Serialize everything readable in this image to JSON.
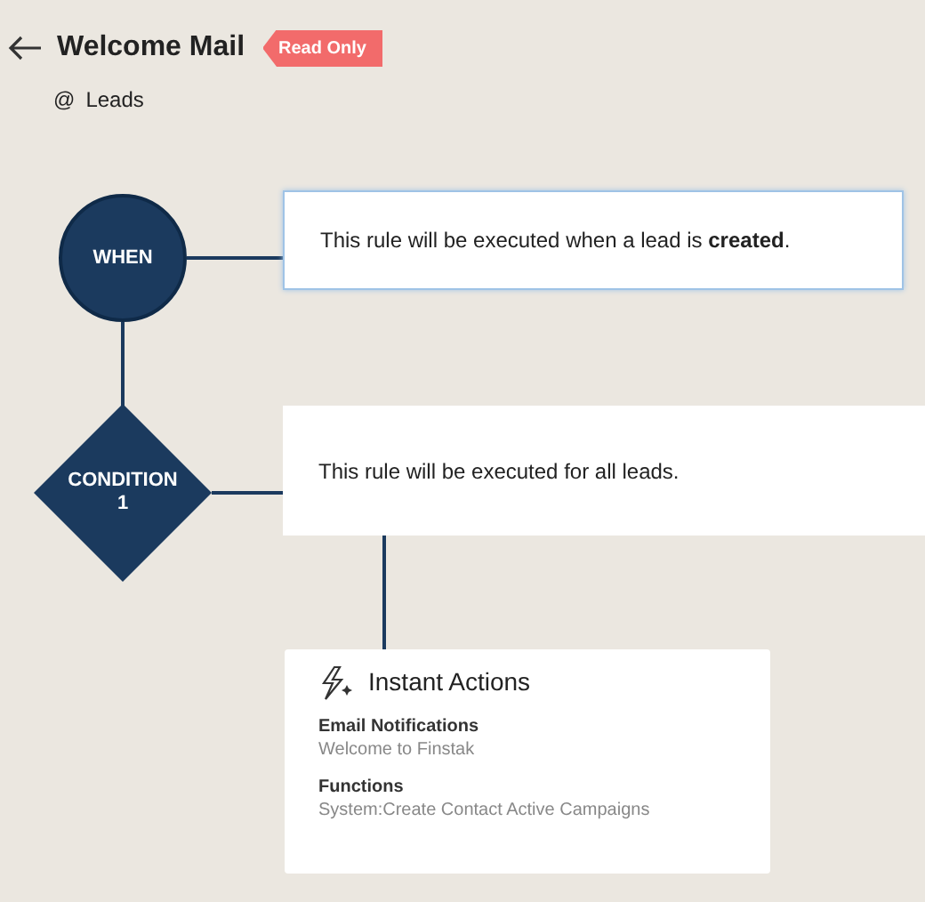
{
  "header": {
    "title": "Welcome Mail",
    "badge": "Read Only",
    "module_symbol": "@",
    "module": "Leads"
  },
  "nodes": [
    {
      "kind": "circle",
      "label": "WHEN",
      "description": "This rule will be executed when a lead is **created**.",
      "highlighted": true
    },
    {
      "kind": "diamond",
      "label": "CONDITION",
      "sublabel": "1",
      "description": "This rule will be executed for all leads.",
      "highlighted": false
    }
  ],
  "actions": {
    "title": "Instant Actions",
    "groups": [
      {
        "heading": "Email Notifications",
        "value": "Welcome to Finstak"
      },
      {
        "heading": "Functions",
        "value": "System:Create Contact Active Campaigns"
      }
    ]
  }
}
